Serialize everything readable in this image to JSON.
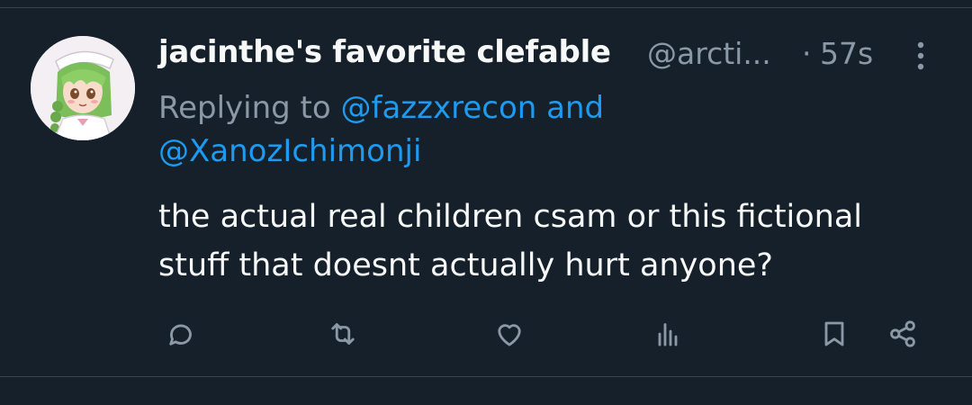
{
  "tweet": {
    "author": {
      "display_name": "jacinthe's favorite clefable",
      "handle": "@arcti..."
    },
    "separator": "·",
    "time": "57s",
    "reply": {
      "prefix": "Replying to",
      "mention_1": "@fazzxrecon",
      "conjunction": "and",
      "mention_2": "@XanozIchimonji"
    },
    "text": "the actual real children csam or this fictional stuff that doesnt actually hurt anyone?"
  },
  "icons": {
    "more": "more-vertical-icon",
    "reply": "reply-icon",
    "retweet": "retweet-icon",
    "like": "heart-icon",
    "views": "views-chart-icon",
    "bookmark": "bookmark-icon",
    "share": "share-icon"
  },
  "colors": {
    "background": "#15202b",
    "primary_text": "#f7f9f9",
    "secondary_text": "#8b98a5",
    "link": "#1d9bf0"
  }
}
